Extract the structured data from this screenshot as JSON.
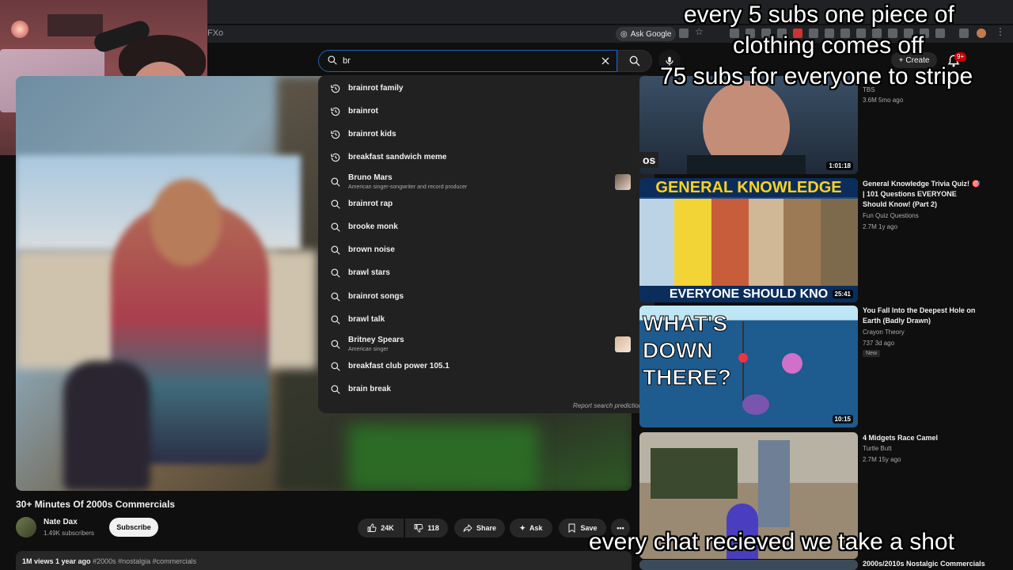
{
  "browser": {
    "url_fragment": "FXo",
    "ask_google_label": "Ask Google"
  },
  "search": {
    "query": "br",
    "suggestions": [
      {
        "label": "brainrot family",
        "kind": "history"
      },
      {
        "label": "brainrot",
        "kind": "history"
      },
      {
        "label": "brainrot kids",
        "kind": "history"
      },
      {
        "label": "breakfast sandwich meme",
        "kind": "history"
      },
      {
        "label": "Bruno Mars",
        "kind": "search",
        "sub": "American singer-songwriter and record producer",
        "thumb": true
      },
      {
        "label": "brainrot rap",
        "kind": "search"
      },
      {
        "label": "brooke monk",
        "kind": "search"
      },
      {
        "label": "brown noise",
        "kind": "search"
      },
      {
        "label": "brawl stars",
        "kind": "search"
      },
      {
        "label": "brainrot songs",
        "kind": "search"
      },
      {
        "label": "brawl talk",
        "kind": "search"
      },
      {
        "label": "Britney Spears",
        "kind": "search",
        "sub": "American singer",
        "thumb": true
      },
      {
        "label": "breakfast club power 105.1",
        "kind": "search"
      },
      {
        "label": "brain break",
        "kind": "search"
      }
    ],
    "report_label": "Report search predictions"
  },
  "header": {
    "create_label": "Create",
    "notif_count": "9+"
  },
  "video": {
    "title": "30+ Minutes Of 2000s Commercials",
    "channel": "Nate Dax",
    "subscribers": "1.49K subscribers",
    "subscribe_label": "Subscribe",
    "likes": "24K",
    "dislikes": "118",
    "share_label": "Share",
    "ask_label": "Ask",
    "save_label": "Save",
    "views_date": "1M views  1 year ago",
    "tags": "#2000s #nostalgia #commercials"
  },
  "related": [
    {
      "title": "",
      "channel": "TBS",
      "stats": "3.6M  5mo ago",
      "duration": "1:01:18"
    },
    {
      "title": "General Knowledge Trivia Quiz! 🎯 | 101 Questions EVERYONE Should Know! (Part 2)",
      "channel": "Fun Quiz Questions",
      "stats": "2.7M  1y ago",
      "duration": "25:41",
      "thumb_text_top": "GENERAL KNOWLEDGE",
      "thumb_text_bottom": "EVERYONE SHOULD KNO"
    },
    {
      "title": "You Fall Into the Deepest Hole on Earth (Badly Drawn)",
      "channel": "Crayon Theory",
      "stats": "737  3d ago",
      "badge": "New",
      "duration": "10:15",
      "thumb_text": "WHAT'S DOWN THERE?"
    },
    {
      "title": "4 Midgets Race Camel",
      "channel": "Turtle Butt",
      "stats": "2.7M  15y ago"
    },
    {
      "title": "2000s/2010s Nostalgic Commercials"
    }
  ],
  "overlays": {
    "line1": "every 5 subs one piece of",
    "line2": "clothing comes off",
    "line3": "75 subs for everyone to stripe",
    "bottom": "every chat recieved we take a shot"
  }
}
